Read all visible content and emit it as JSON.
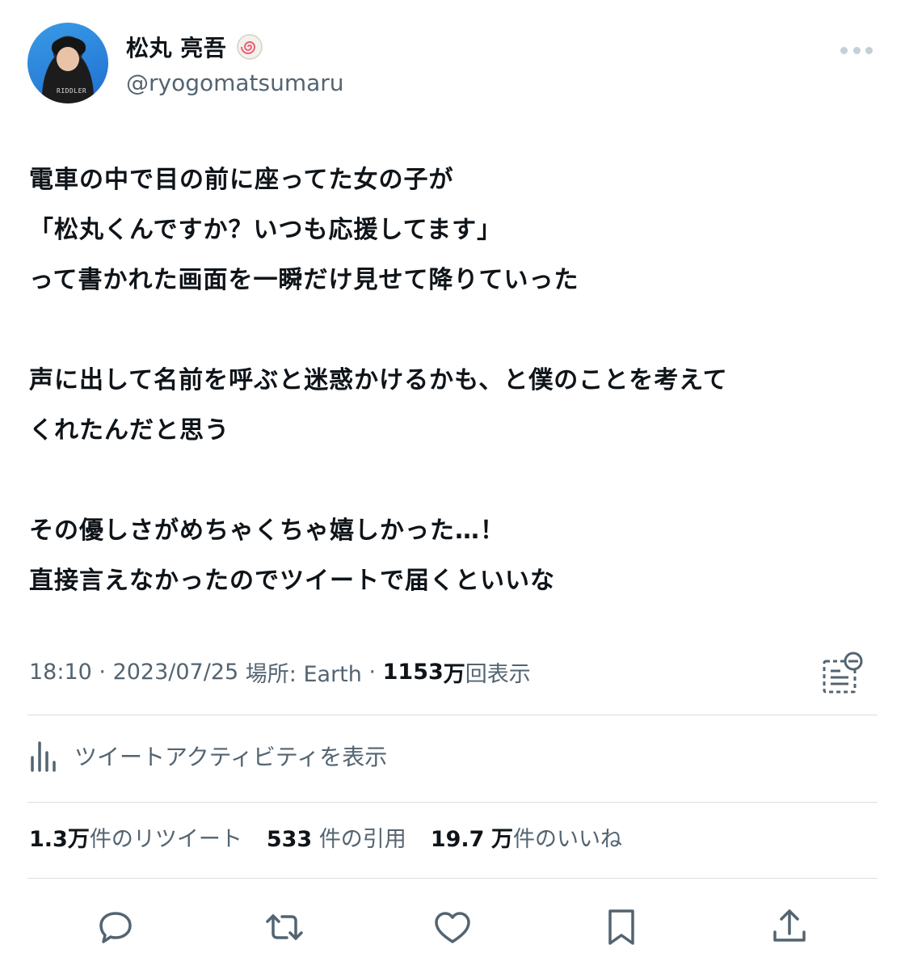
{
  "tweet": {
    "display_name": "松丸 亮吾",
    "handle": "@ryogomatsumaru",
    "avatar_shirt_text": "RIDDLER",
    "body_paragraphs": [
      [
        "電車の中で目の前に座ってた女の子が",
        "「松丸くんですか？いつも応援してます」",
        "って書かれた画面を一瞬だけ見せて降りていった"
      ],
      [
        "声に出して名前を呼ぶと迷惑かけるかも、と僕のことを考えて",
        "くれたんだと思う"
      ],
      [
        "その優しさがめちゃくちゃ嬉しかった…！",
        "直接言えなかったのでツイートで届くといいな"
      ]
    ],
    "meta": {
      "time": "18:10",
      "date": "2023/07/25",
      "location_label": "場所: Earth",
      "views_count": "1153",
      "views_unit": "万",
      "views_label": "回表示"
    },
    "activity_label": "ツイートアクティビティを表示",
    "counts": {
      "retweets_num": "1.3",
      "retweets_unit": "万",
      "retweets_label": "件のリツイート",
      "quotes_num": "533",
      "quotes_label": "件の引用",
      "likes_num": "19.7",
      "likes_unit": "万",
      "likes_label": "件のいいね"
    },
    "actions": [
      "reply-icon",
      "retweet-icon",
      "like-icon",
      "bookmark-icon",
      "share-icon"
    ],
    "colors": {
      "text": "#0f1419",
      "secondary": "#536471",
      "divider": "#d9dfe3"
    }
  }
}
